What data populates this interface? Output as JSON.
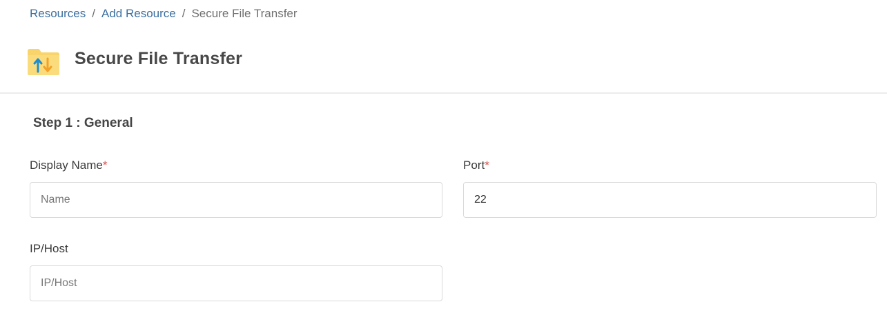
{
  "breadcrumb": {
    "items": [
      {
        "label": "Resources"
      },
      {
        "label": "Add Resource"
      },
      {
        "label": "Secure File Transfer"
      }
    ],
    "separator": "/"
  },
  "header": {
    "title": "Secure File Transfer",
    "icon": "folder-transfer-icon"
  },
  "form": {
    "step_title": "Step 1 : General",
    "required_marker": "*",
    "display_name": {
      "label": "Display Name",
      "placeholder": "Name",
      "value": ""
    },
    "port": {
      "label": "Port",
      "placeholder": "",
      "value": "22"
    },
    "ip_host": {
      "label": "IP/Host",
      "placeholder": "IP/Host",
      "value": ""
    }
  },
  "colors": {
    "link": "#3b6fa0",
    "required": "#d9534f",
    "icon_folder": "#f9d46a",
    "icon_arrow_up": "#1f8ecf",
    "icon_arrow_down": "#f0a22a"
  }
}
